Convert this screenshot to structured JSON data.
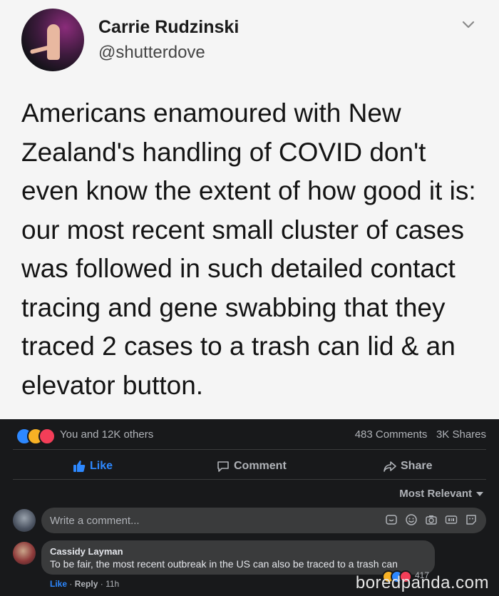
{
  "tweet": {
    "author_name": "Carrie Rudzinski",
    "handle": "@shutterdove",
    "text": "Americans enamoured with New Zealand's handling of COVID don't even know the extent of how good it is: our most recent small cluster of cases was followed in such detailed contact tracing and gene swabbing that they traced 2 cases to a trash can lid & an elevator button."
  },
  "facebook": {
    "reaction_summary": "You and 12K others",
    "comment_count": "483 Comments",
    "share_count": "3K Shares",
    "actions": {
      "like": "Like",
      "comment": "Comment",
      "share": "Share"
    },
    "sort_label": "Most Relevant",
    "comment_input_placeholder": "Write a comment...",
    "comment": {
      "author": "Cassidy Layman",
      "text": "To be fair, the most recent outbreak in the US can also be traced to a trash can",
      "reaction_count": "417",
      "like_label": "Like",
      "reply_label": "Reply",
      "time": "11h"
    },
    "accent_color": "#2d88ff"
  },
  "watermark": "boredpanda.com"
}
